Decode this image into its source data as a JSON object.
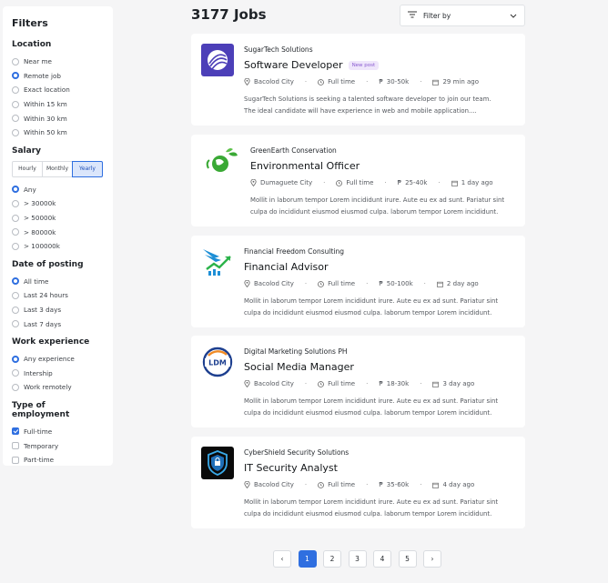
{
  "filters": {
    "title": "Filters",
    "location": {
      "heading": "Location",
      "options": [
        "Near me",
        "Remote job",
        "Exact location",
        "Within 15 km",
        "Within 30 km",
        "Within 50 km"
      ],
      "selected": "Remote job"
    },
    "salary": {
      "heading": "Salary",
      "periods": [
        "Hourly",
        "Monthly",
        "Yearly"
      ],
      "selected_period": "Yearly",
      "options": [
        "Any",
        "> 30000k",
        "> 50000k",
        "> 80000k",
        "> 100000k"
      ],
      "selected": "Any"
    },
    "date_of_posting": {
      "heading": "Date of posting",
      "options": [
        "All time",
        "Last 24 hours",
        "Last 3 days",
        "Last 7 days"
      ],
      "selected": "All time"
    },
    "work_experience": {
      "heading": "Work experience",
      "options": [
        "Any experience",
        "Intership",
        "Work remotely"
      ],
      "selected": "Any experience"
    },
    "employment_type": {
      "heading": "Type of employment",
      "options": [
        "Full-time",
        "Temporary",
        "Part-time"
      ],
      "checked": [
        "Full-time"
      ]
    }
  },
  "header": {
    "jobs_count": "3177 Jobs",
    "filter_by": "Filter by"
  },
  "jobs": [
    {
      "company": "SugarTech Solutions",
      "title": "Software Developer",
      "badge": "New post",
      "location": "Bacolod City",
      "type": "Full time",
      "salary": "30-50k",
      "posted": "29 min ago",
      "description_line1": "SugarTech Solutions is seeking a talented software developer to join our team.",
      "description_line2": "The ideal candidate will have experience in web and mobile application....",
      "logo_icon": "sugartech-logo-icon"
    },
    {
      "company": "GreenEarth Conservation",
      "title": "Environmental Officer",
      "badge": "",
      "location": "Dumaguete City",
      "type": "Full time",
      "salary": "25-40k",
      "posted": "1 day ago",
      "description_line1": "Mollit in laborum tempor Lorem incididunt irure. Aute eu ex ad sunt. Pariatur sint",
      "description_line2": "culpa do incididunt eiusmod eiusmod culpa. laborum tempor Lorem incididunt.",
      "logo_icon": "greenearth-logo-icon"
    },
    {
      "company": "Financial Freedom Consulting",
      "title": "Financial Advisor",
      "badge": "",
      "location": "Bacolod City",
      "type": "Full time",
      "salary": "50-100k",
      "posted": "2 day ago",
      "description_line1": "Mollit in laborum tempor Lorem incididunt irure. Aute eu ex ad sunt. Pariatur sint",
      "description_line2": "culpa do incididunt eiusmod eiusmod culpa. laborum tempor Lorem incididunt.",
      "logo_icon": "financial-freedom-logo-icon"
    },
    {
      "company": "Digital Marketing Solutions PH",
      "title": "Social Media Manager",
      "badge": "",
      "location": "Bacolod City",
      "type": "Full time",
      "salary": "18-30k",
      "posted": "3 day ago",
      "description_line1": "Mollit in laborum tempor Lorem incididunt irure. Aute eu ex ad sunt. Pariatur sint",
      "description_line2": "culpa do incididunt eiusmod eiusmod culpa. laborum tempor Lorem incididunt.",
      "logo_icon": "ldm-logo-icon",
      "logo_text": "LDM"
    },
    {
      "company": "CyberShield Security Solutions",
      "title": "IT Security Analyst",
      "badge": "",
      "location": "Bacolod City",
      "type": "Full time",
      "salary": "35-60k",
      "posted": "4 day ago",
      "description_line1": "Mollit in laborum tempor Lorem incididunt irure. Aute eu ex ad sunt. Pariatur sint",
      "description_line2": "culpa do incididunt eiusmod eiusmod culpa. laborum tempor Lorem incididunt.",
      "logo_icon": "cybershield-logo-icon"
    }
  ],
  "pagination": {
    "pages": [
      "1",
      "2",
      "3",
      "4",
      "5"
    ],
    "current": "1",
    "prev": "‹",
    "next": "›"
  },
  "colors": {
    "accent": "#2f6fe0",
    "badge_bg": "#efe6fb",
    "badge_text": "#8a5cd1"
  }
}
